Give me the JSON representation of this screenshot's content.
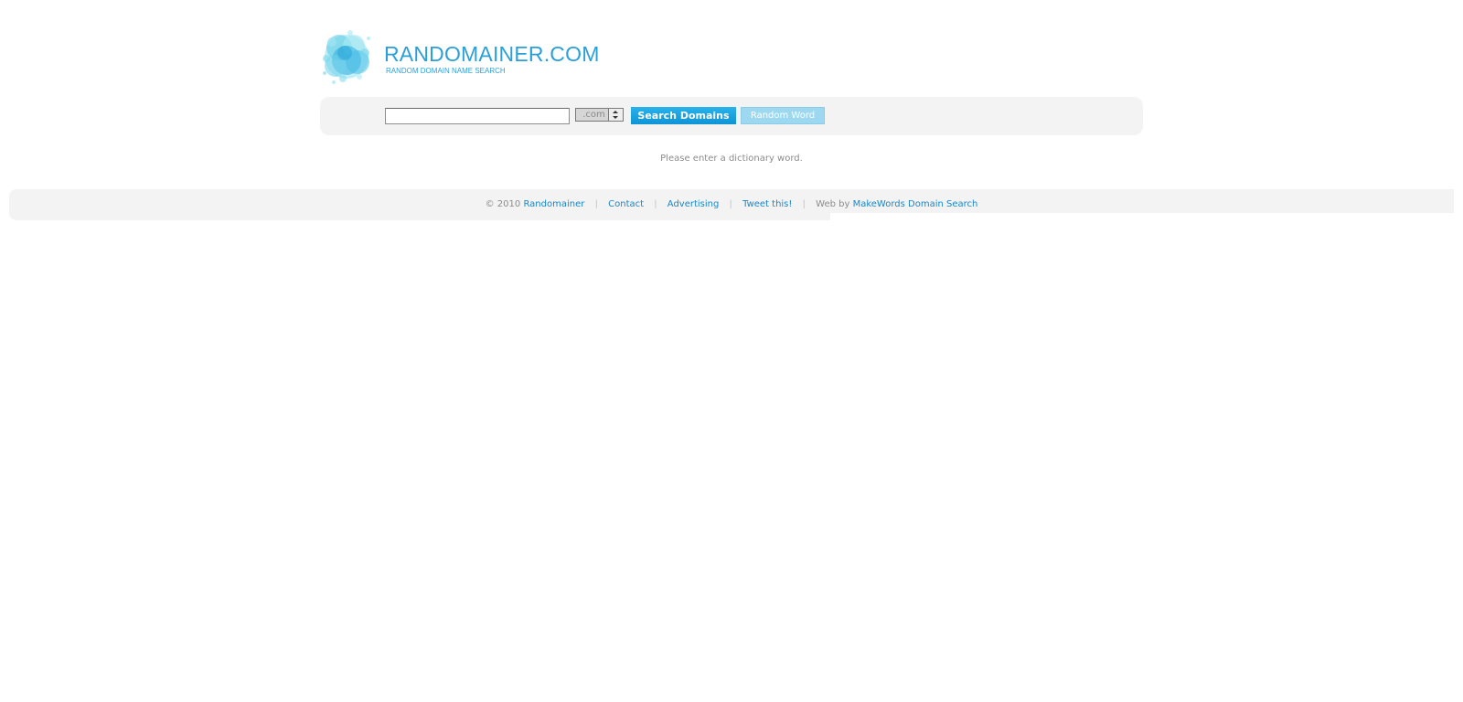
{
  "header": {
    "title": "RANDOMAINER.COM",
    "tagline": "RANDOM DOMAIN NAME SEARCH"
  },
  "search": {
    "input_value": "",
    "tld_selected": ".com",
    "search_button_label": "Search Domains",
    "random_button_label": "Random Word"
  },
  "message": "Please enter a dictionary word.",
  "footer": {
    "copyright": "© 2010",
    "site_link": "Randomainer",
    "contact_link": "Contact",
    "advertising_link": "Advertising",
    "tweet_link": "Tweet this!",
    "web_by": "Web by",
    "makewords_link": "MakeWords Domain Search",
    "separator": "|"
  },
  "colors": {
    "brand": "#2a9fd8",
    "link": "#1a87c9",
    "button": "#1aa3e0",
    "panel": "#f3f3f3"
  }
}
